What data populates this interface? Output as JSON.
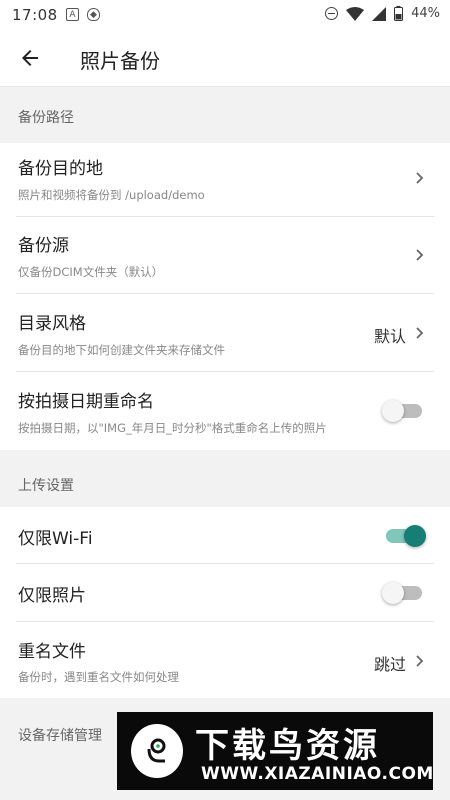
{
  "status_bar": {
    "time": "17:08",
    "left_icons": [
      "a-icon",
      "shield-icon"
    ],
    "right_icons": [
      "dnd-icon",
      "wifi-icon",
      "signal-icon",
      "battery-icon"
    ],
    "battery": "44%"
  },
  "app_bar": {
    "back_icon": "arrow-back-icon",
    "title": "照片备份"
  },
  "sections": {
    "backup_path": "备份路径",
    "upload_settings": "上传设置",
    "device_storage": "设备存储管理"
  },
  "items": {
    "destination": {
      "title": "备份目的地",
      "subtitle": "照片和视频将备份到 /upload/demo"
    },
    "source": {
      "title": "备份源",
      "subtitle": "仅备份DCIM文件夹（默认）"
    },
    "dir_style": {
      "title": "目录风格",
      "subtitle": "备份目的地下如何创建文件夹来存储文件",
      "value": "默认"
    },
    "rename_by_date": {
      "title": "按拍摄日期重命名",
      "subtitle": "按拍摄日期，以\"IMG_年月日_时分秒\"格式重命名上传的照片",
      "enabled": false
    },
    "wifi_only": {
      "title": "仅限Wi-Fi",
      "enabled": true
    },
    "photos_only": {
      "title": "仅限照片",
      "enabled": false
    },
    "duplicate": {
      "title": "重名文件",
      "subtitle": "备份时，遇到重名文件如何处理",
      "value": "跳过"
    }
  },
  "colors": {
    "accent": "#167e74",
    "accent_track": "#7fc6bb",
    "section_bg": "#f2f2f2"
  },
  "watermark": {
    "title": "下载鸟资源",
    "url": "WWW.XIAZAINIAO.COM"
  }
}
